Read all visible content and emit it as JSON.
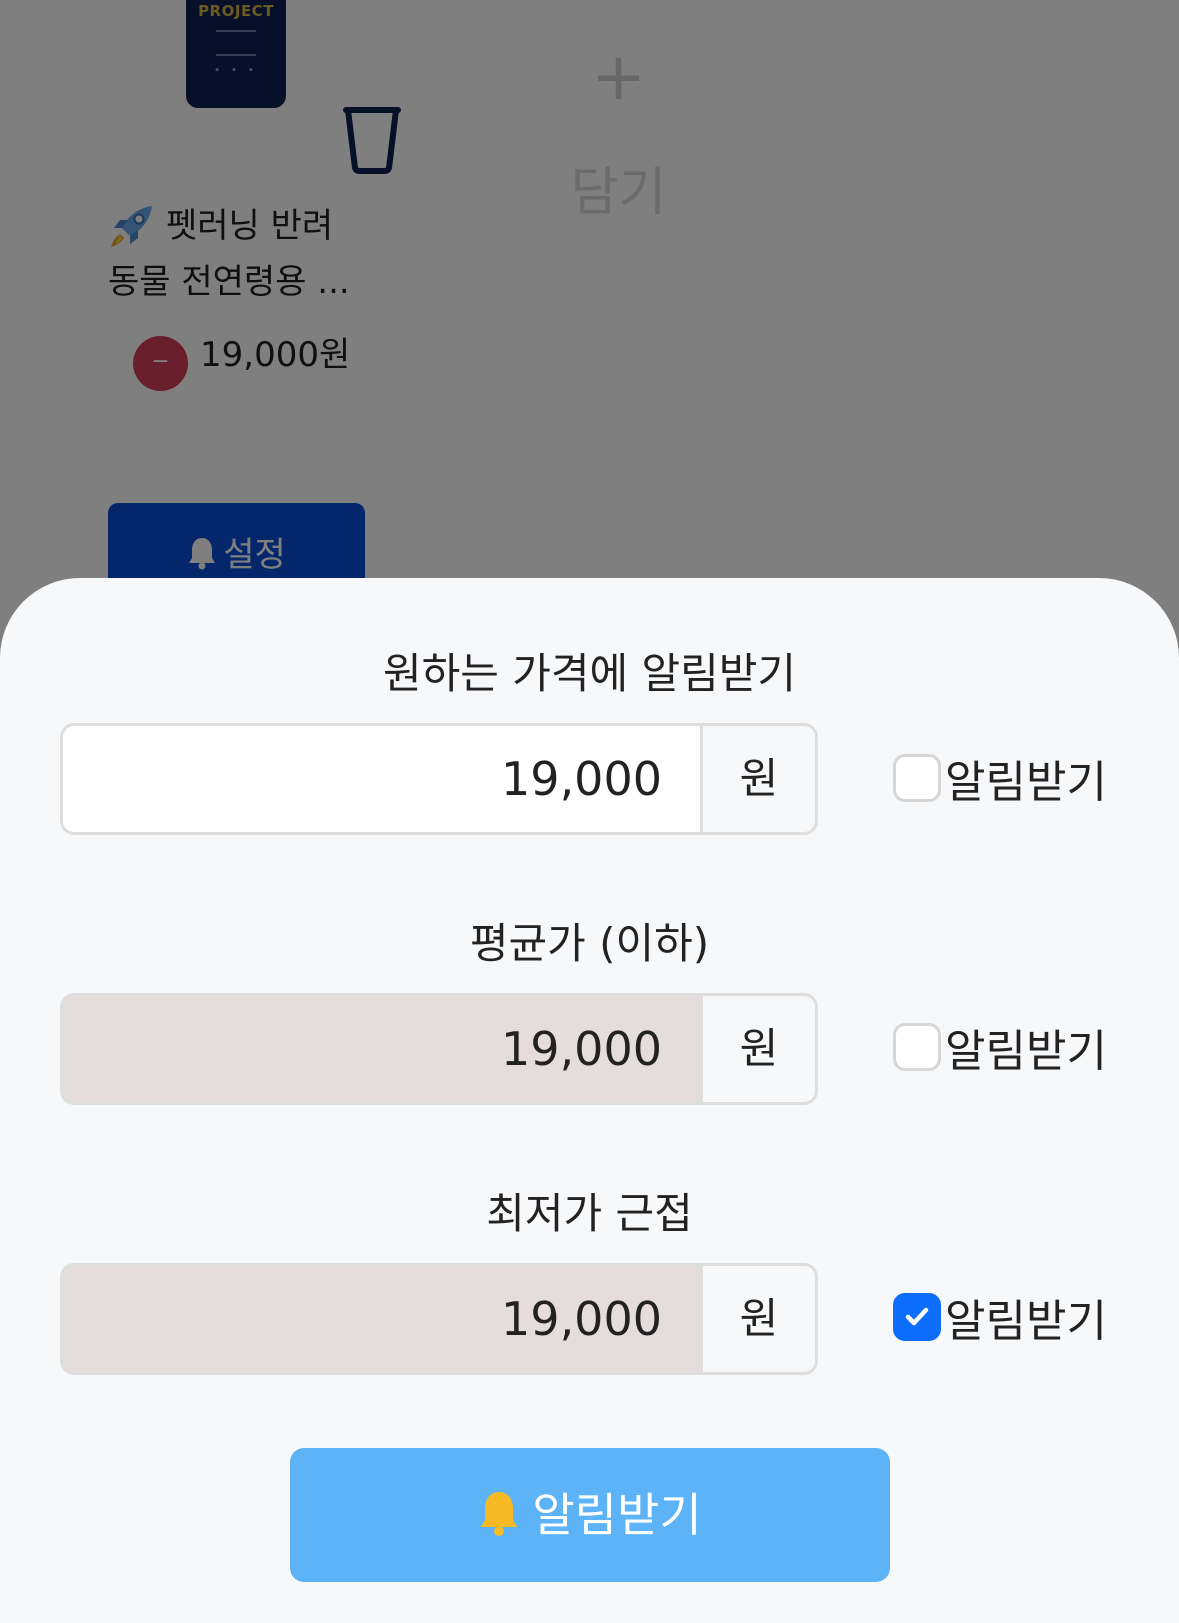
{
  "background": {
    "product_brand": "PROJECT",
    "product_name": "펫러닝 반려동물 전연령용 ...",
    "product_price": "19,000원",
    "minus_label": "−",
    "add_plus": "+",
    "add_label": "담기",
    "setup_label": "설정"
  },
  "sheet": {
    "sections": [
      {
        "title": "원하는 가격에 알림받기",
        "value": "19,000",
        "unit": "원",
        "check_label": "알림받기",
        "checked": false,
        "editable": true
      },
      {
        "title": "평균가 (이하)",
        "value": "19,000",
        "unit": "원",
        "check_label": "알림받기",
        "checked": false,
        "editable": false
      },
      {
        "title": "최저가 근접",
        "value": "19,000",
        "unit": "원",
        "check_label": "알림받기",
        "checked": true,
        "editable": false
      }
    ],
    "submit_label": "알림받기"
  },
  "colors": {
    "primary": "#0b4cd5",
    "checkbox_checked": "#0d6efd",
    "submit_button": "#5db3f7",
    "disabled_input": "#e5dcdc",
    "bell_yellow": "#f7b924"
  }
}
